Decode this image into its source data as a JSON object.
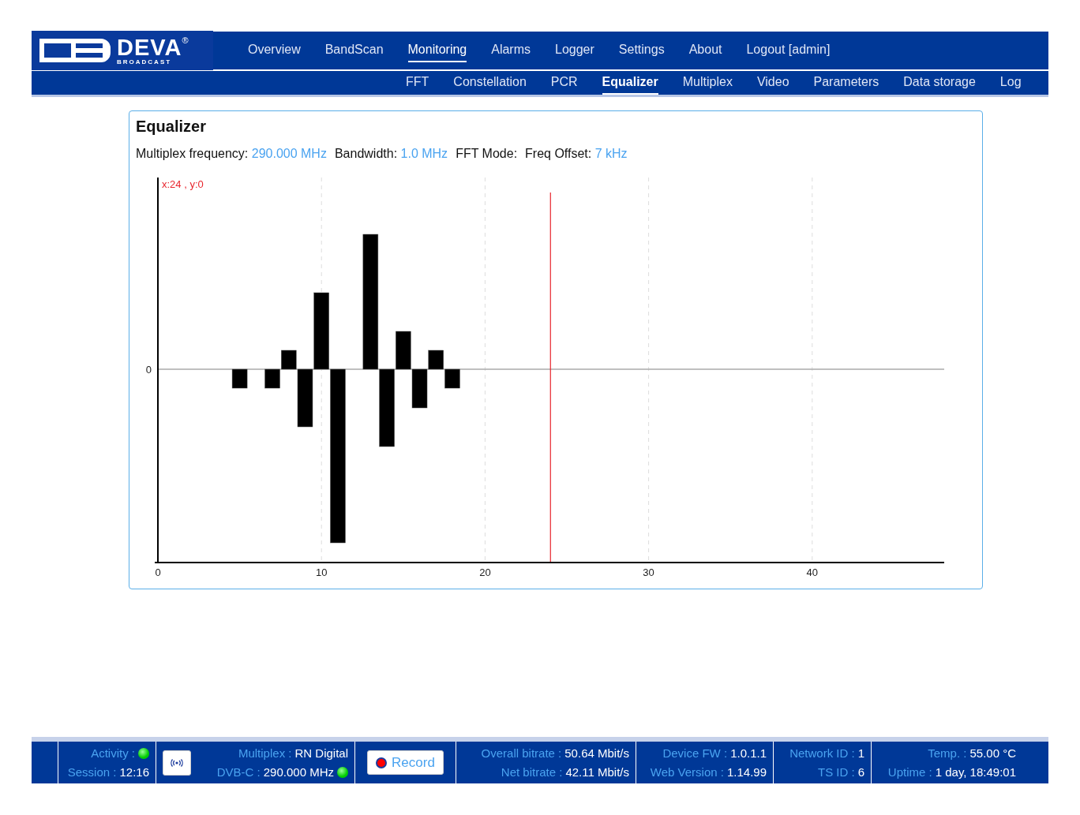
{
  "logo": {
    "name": "DEVA",
    "mark": "®",
    "tagline": "BROADCAST"
  },
  "nav": {
    "main": [
      {
        "label": "Overview",
        "selected": false
      },
      {
        "label": "BandScan",
        "selected": false
      },
      {
        "label": "Monitoring",
        "selected": true
      },
      {
        "label": "Alarms",
        "selected": false
      },
      {
        "label": "Logger",
        "selected": false
      },
      {
        "label": "Settings",
        "selected": false
      },
      {
        "label": "About",
        "selected": false
      },
      {
        "label": "Logout [admin]",
        "selected": false
      }
    ],
    "sub": [
      {
        "label": "FFT",
        "selected": false
      },
      {
        "label": "Constellation",
        "selected": false
      },
      {
        "label": "PCR",
        "selected": false
      },
      {
        "label": "Equalizer",
        "selected": true
      },
      {
        "label": "Multiplex",
        "selected": false
      },
      {
        "label": "Video",
        "selected": false
      },
      {
        "label": "Parameters",
        "selected": false
      },
      {
        "label": "Data storage",
        "selected": false
      },
      {
        "label": "Log",
        "selected": false
      }
    ]
  },
  "panel": {
    "title": "Equalizer",
    "info": [
      {
        "label": "Multiplex frequency:",
        "value": "290.000 MHz"
      },
      {
        "label": "Bandwidth:",
        "value": "1.0 MHz"
      },
      {
        "label": "FFT Mode:"
      },
      {
        "label": "Freq Offset:",
        "value": "7 kHz"
      }
    ],
    "chart": {
      "cursor_label": "x:24 , y:0",
      "y_ticks": [
        "0"
      ],
      "x_ticks": [
        "0",
        "10",
        "20",
        "30",
        "40"
      ]
    }
  },
  "status_bar": [
    {
      "kind": "info",
      "rows": [
        {
          "label": "Activity :",
          "indicator_on": true
        },
        {
          "label": "Session :",
          "value": "12:16"
        }
      ]
    },
    {
      "kind": "multiplex",
      "rows": [
        {
          "label": "Multiplex :",
          "value": "RN Digital"
        },
        {
          "label": "DVB-C :",
          "value": "290.000 MHz",
          "indicator_on": true
        }
      ]
    },
    {
      "kind": "record",
      "label": "Record"
    },
    {
      "kind": "info",
      "rows": [
        {
          "label": "Overall bitrate :",
          "value": "50.64 Mbit/s"
        },
        {
          "label": "Net bitrate :",
          "value": "42.11 Mbit/s"
        }
      ]
    },
    {
      "kind": "info",
      "rows": [
        {
          "label": "Device FW :",
          "value": "1.0.1.1"
        },
        {
          "label": "Web Version :",
          "value": "1.14.99"
        }
      ]
    },
    {
      "kind": "info",
      "rows": [
        {
          "label": "Network ID :",
          "value": "1"
        },
        {
          "label": "TS ID :",
          "value": "6"
        }
      ]
    },
    {
      "kind": "info",
      "rows": [
        {
          "label": "Temp. :",
          "value": "55.00 °C"
        },
        {
          "label": "Uptime :",
          "value": "1 day, 18:49:01"
        }
      ]
    }
  ]
}
